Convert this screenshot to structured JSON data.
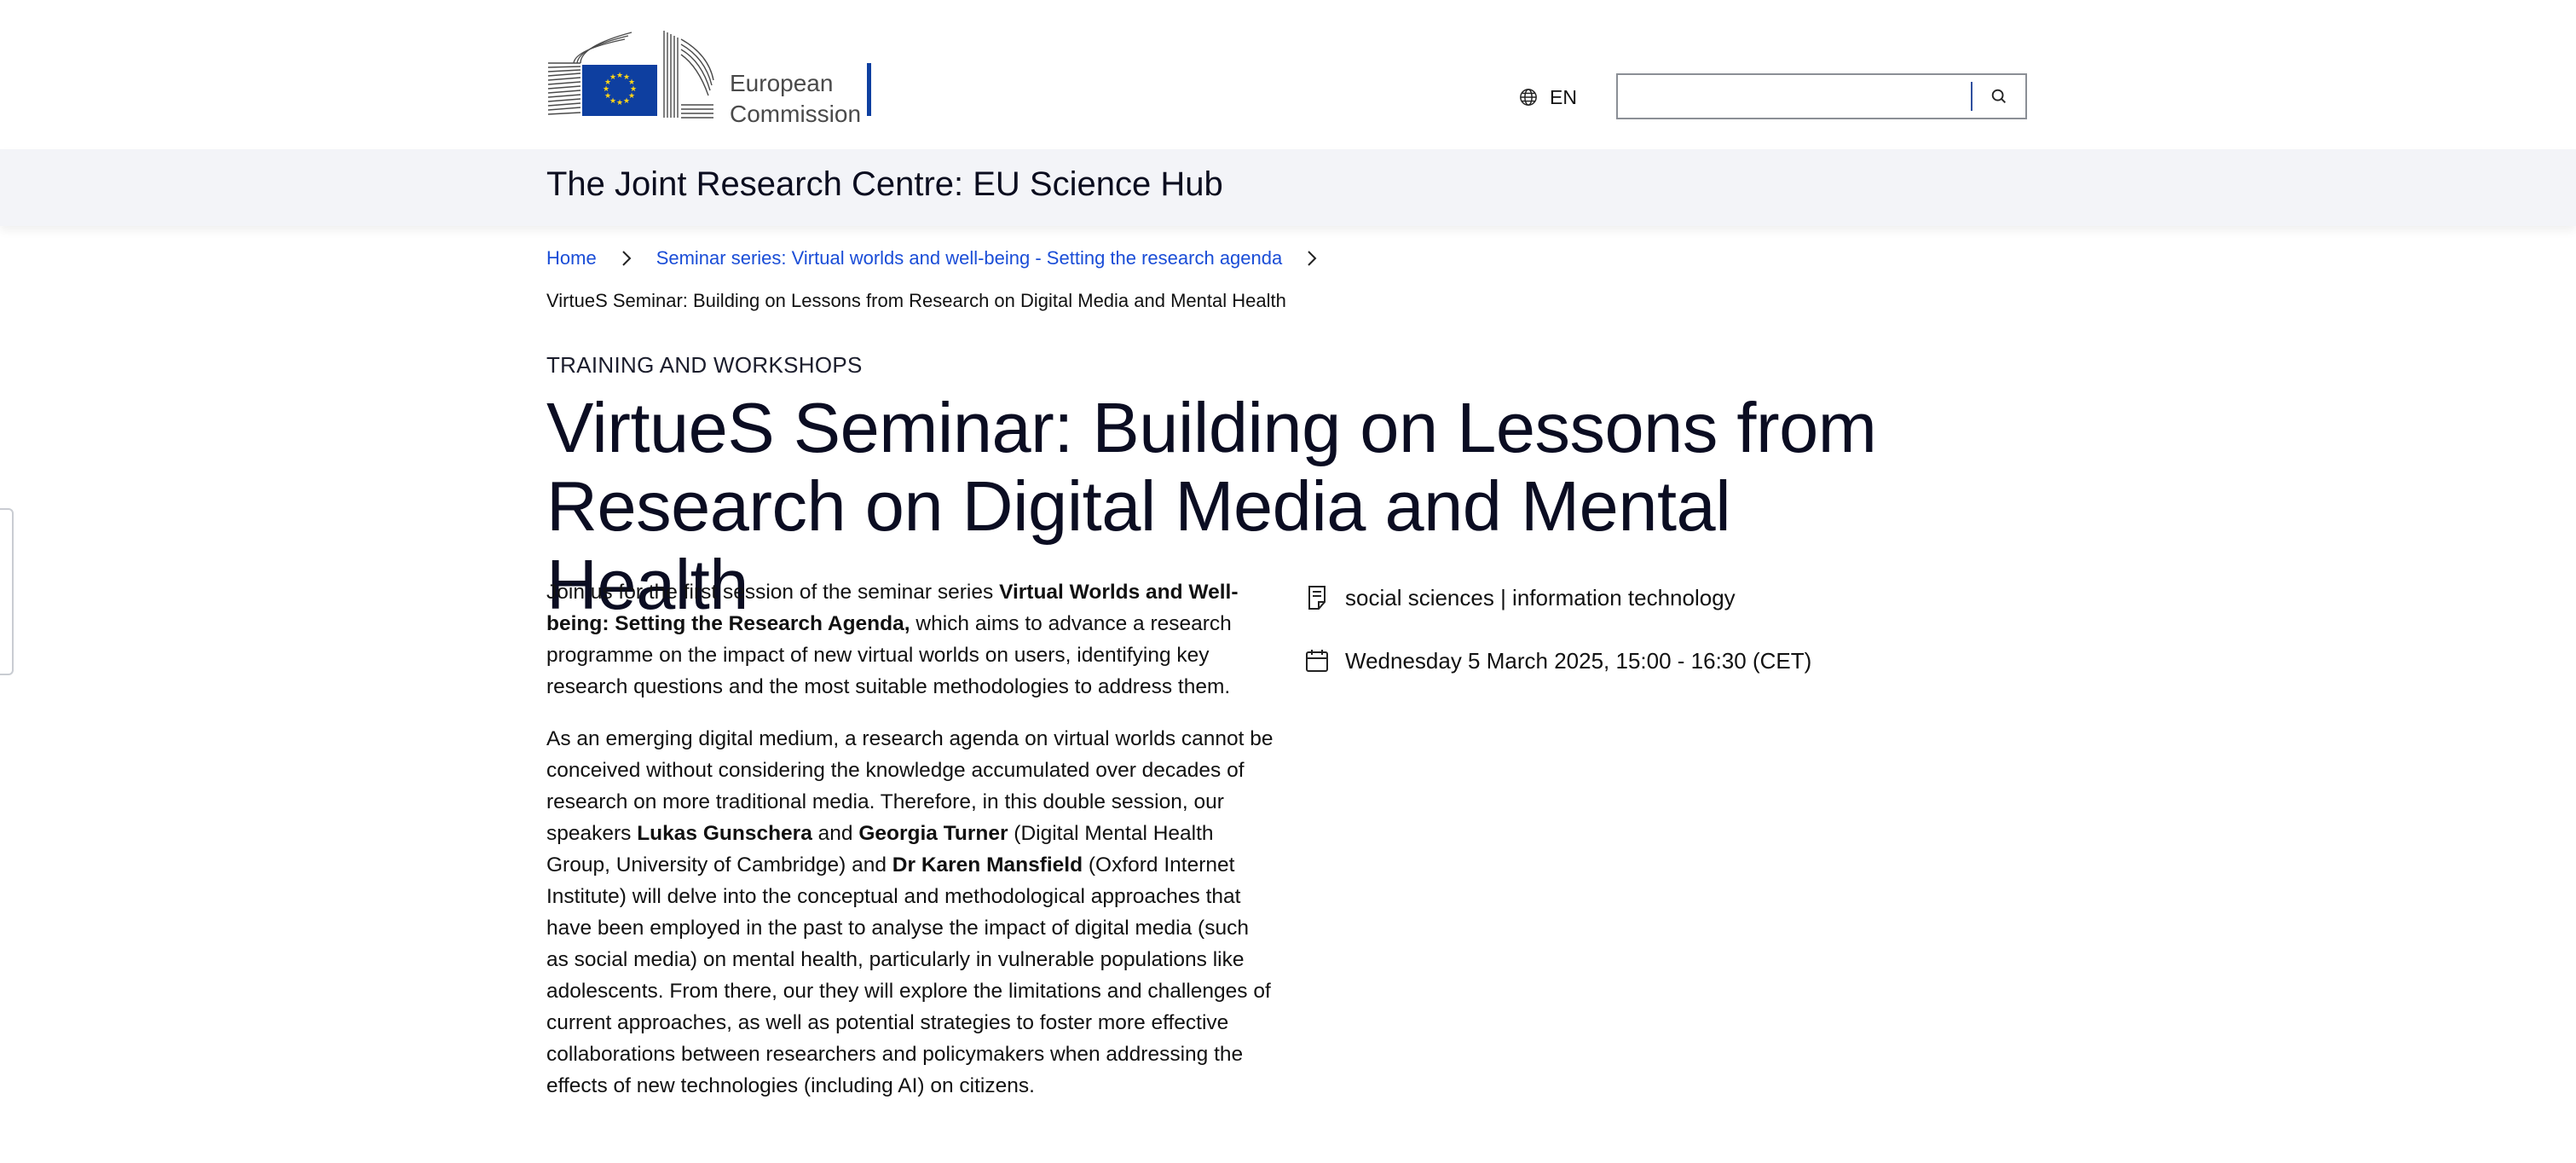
{
  "header": {
    "logo_line1": "European",
    "logo_line2": "Commission",
    "language": "EN",
    "search_placeholder": "",
    "colors": {
      "eu_blue": "#0e3fa0",
      "eu_star": "#ffd617",
      "link": "#1a4dd7"
    }
  },
  "site": {
    "name": "The Joint Research Centre: EU Science Hub"
  },
  "breadcrumb": {
    "items": [
      {
        "label": "Home"
      },
      {
        "label": "Seminar series: Virtual worlds and well-being - Setting the research agenda"
      }
    ],
    "current": "VirtueS Seminar: Building on Lessons from Research on Digital Media and Mental Health"
  },
  "page": {
    "type": "TRAINING AND WORKSHOPS",
    "title": "VirtueS Seminar: Building on Lessons from Research on Digital Media and Mental Health"
  },
  "body": {
    "p1": {
      "a": "Join us for the first session of the seminar series ",
      "b": "Virtual Worlds and Well-being: Setting the Research Agenda,",
      "c": " which aims to advance a research programme on the impact of new virtual worlds on users, identifying key research questions and the most suitable methodologies to address them."
    },
    "p2": {
      "a": "As an emerging digital medium, a research agenda on virtual worlds cannot be conceived without considering the knowledge accumulated over decades of research on more traditional media. Therefore, in this double session, our speakers ",
      "speaker1": "Lukas Gunschera",
      "and": " and ",
      "speaker2": "Georgia Turner",
      "b": " (Digital Mental Health Group, University of Cambridge) and ",
      "speaker3": "Dr Karen Mansfield",
      "c": " (Oxford Internet Institute) will delve into the conceptual and methodological approaches that have been employed in the past to analyse the impact of digital media (such as social media) on mental health, particularly in vulnerable populations like adolescents. From there, our they will explore the limitations and challenges of current approaches, as well as potential strategies to foster more effective collaborations between researchers and policymakers when addressing the effects of new technologies (including AI) on citizens."
    }
  },
  "sidebar": {
    "topics_icon": "document-icon",
    "topics": "social sciences | information technology",
    "date_icon": "calendar-icon",
    "date": "Wednesday 5 March 2025, 15:00 - 16:30 (CET)"
  }
}
